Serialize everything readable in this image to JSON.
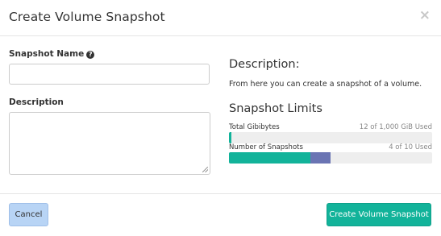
{
  "modal": {
    "title": "Create Volume Snapshot",
    "close_symbol": "×"
  },
  "form": {
    "snapshot_name_label": "Snapshot Name",
    "snapshot_name_value": "",
    "description_label": "Description",
    "description_value": ""
  },
  "info": {
    "description_heading": "Description:",
    "description_text": "From here you can create a snapshot of a volume.",
    "limits_heading": "Snapshot Limits",
    "limits": [
      {
        "label": "Total Gibibytes",
        "usage_text": "12 of 1,000 GiB Used",
        "used_fraction": 0.012,
        "color": "#12b39a"
      },
      {
        "label": "Number of Snapshots",
        "usage_text": "4 of 10 Used",
        "used_fraction": 0.4,
        "added_fraction": 0.1,
        "color": "#12b39a",
        "added_color": "#6a74b3"
      }
    ]
  },
  "footer": {
    "cancel_label": "Cancel",
    "submit_label": "Create Volume Snapshot"
  },
  "colors": {
    "primary": "#12b39a",
    "cancel_bg": "#b8d4f5",
    "pending": "#6a74b3"
  }
}
